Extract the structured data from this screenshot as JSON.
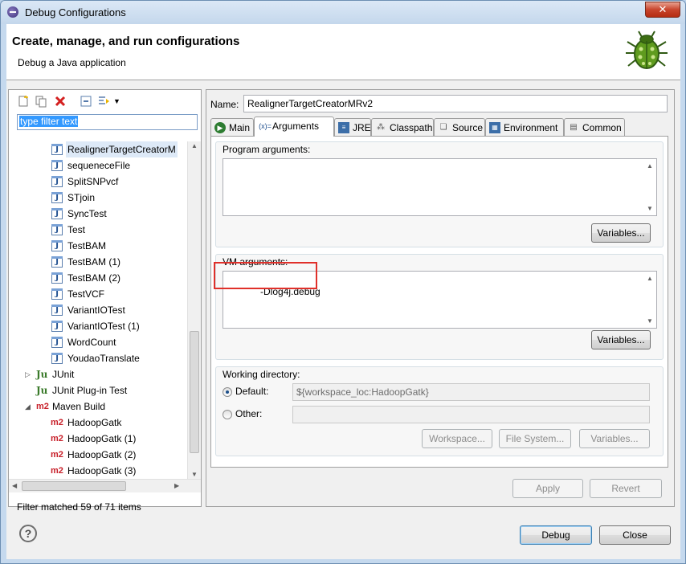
{
  "window": {
    "title": "Debug Configurations",
    "close_label": "✕"
  },
  "header": {
    "title": "Create, manage, and run configurations",
    "subtitle": "Debug a Java application"
  },
  "sidebar": {
    "filter_text": "type filter text",
    "tree": [
      {
        "label": "RealignerTargetCreatorM",
        "type": "java",
        "selected": true
      },
      {
        "label": "sequeneceFile",
        "type": "java"
      },
      {
        "label": "SplitSNPvcf",
        "type": "java"
      },
      {
        "label": "STjoin",
        "type": "java"
      },
      {
        "label": "SyncTest",
        "type": "java"
      },
      {
        "label": "Test",
        "type": "java"
      },
      {
        "label": "TestBAM",
        "type": "java"
      },
      {
        "label": "TestBAM (1)",
        "type": "java"
      },
      {
        "label": "TestBAM (2)",
        "type": "java"
      },
      {
        "label": "TestVCF",
        "type": "java"
      },
      {
        "label": "VariantIOTest",
        "type": "java"
      },
      {
        "label": "VariantIOTest (1)",
        "type": "java"
      },
      {
        "label": "WordCount",
        "type": "java"
      },
      {
        "label": "YoudaoTranslate",
        "type": "java"
      },
      {
        "label": "JUnit",
        "type": "junit-category"
      },
      {
        "label": "JUnit Plug-in Test",
        "type": "junit-plugin"
      },
      {
        "label": "Maven Build",
        "type": "maven-category"
      },
      {
        "label": "HadoopGatk",
        "type": "maven"
      },
      {
        "label": "HadoopGatk (1)",
        "type": "maven"
      },
      {
        "label": "HadoopGatk (2)",
        "type": "maven"
      },
      {
        "label": "HadoopGatk (3)",
        "type": "maven"
      }
    ],
    "status": "Filter matched 59 of 71 items"
  },
  "config": {
    "name_label": "Name:",
    "name_value": "RealignerTargetCreatorMRv2",
    "tabs": [
      {
        "label": "Main",
        "icon": "main-tab-icon"
      },
      {
        "label": "Arguments",
        "icon": "arguments-tab-icon",
        "active": true
      },
      {
        "label": "JRE",
        "icon": "jre-tab-icon"
      },
      {
        "label": "Classpath",
        "icon": "classpath-tab-icon"
      },
      {
        "label": "Source",
        "icon": "source-tab-icon"
      },
      {
        "label": "Environment",
        "icon": "environment-tab-icon"
      },
      {
        "label": "Common",
        "icon": "common-tab-icon"
      }
    ],
    "program_args": {
      "title": "Program arguments:",
      "value": "",
      "variables_label": "Variables..."
    },
    "vm_args": {
      "title": "VM arguments:",
      "value": "-Dlog4j.debug",
      "variables_label": "Variables..."
    },
    "working_dir": {
      "title": "Working directory:",
      "default_label": "Default:",
      "default_value": "${workspace_loc:HadoopGatk}",
      "other_label": "Other:",
      "other_value": "",
      "workspace_label": "Workspace...",
      "filesystem_label": "File System...",
      "variables_label": "Variables..."
    },
    "apply_label": "Apply",
    "revert_label": "Revert"
  },
  "footer": {
    "help_label": "?",
    "debug_label": "Debug",
    "close_label": "Close"
  }
}
